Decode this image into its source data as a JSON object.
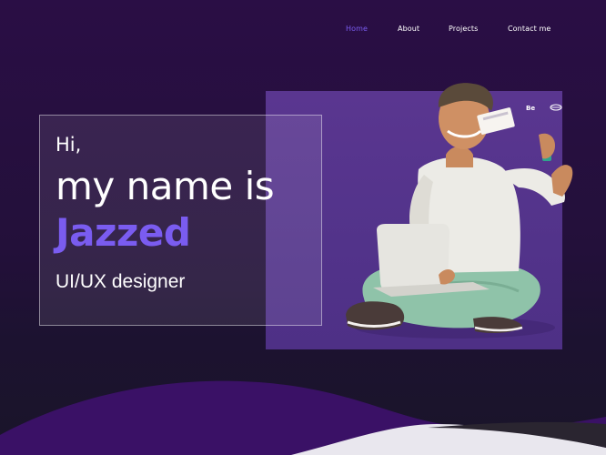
{
  "nav": {
    "items": [
      {
        "label": "Home",
        "active": true
      },
      {
        "label": "About",
        "active": false
      },
      {
        "label": "Projects",
        "active": false
      },
      {
        "label": "Contact me",
        "active": false
      }
    ]
  },
  "hero": {
    "greeting": "Hi,",
    "intro": "my name is",
    "name": "Jazzed",
    "role": "UI/UX designer"
  },
  "social": {
    "behance_label": "Be"
  },
  "colors": {
    "accent": "#7a5cf0",
    "background": "#2a0e45",
    "panel": "#56348c"
  },
  "icons": [
    "dribbble-icon",
    "behance-icon",
    "email-icon"
  ]
}
